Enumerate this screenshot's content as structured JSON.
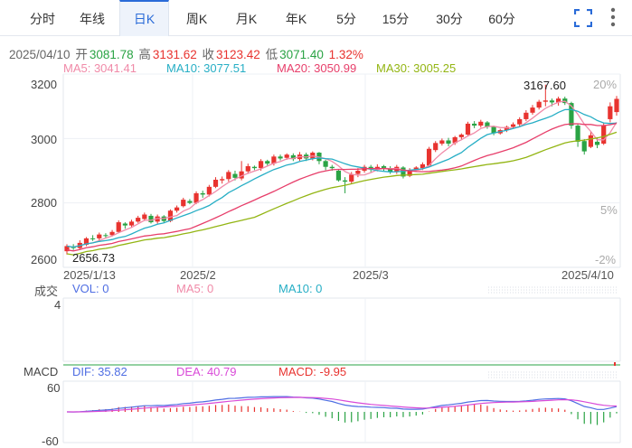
{
  "tabs": [
    {
      "label": "分时",
      "active": false
    },
    {
      "label": "年线",
      "active": false
    },
    {
      "label": "日K",
      "active": true
    },
    {
      "label": "周K",
      "active": false
    },
    {
      "label": "月K",
      "active": false
    },
    {
      "label": "年K",
      "active": false
    },
    {
      "label": "5分",
      "active": false
    },
    {
      "label": "15分",
      "active": false
    },
    {
      "label": "30分",
      "active": false
    },
    {
      "label": "60分",
      "active": false
    }
  ],
  "ohlc": {
    "date": "2025/04/10",
    "open_label": "开",
    "open": "3081.78",
    "high_label": "高",
    "high": "3131.62",
    "close_label": "收",
    "close": "3123.42",
    "low_label": "低",
    "low": "3071.40",
    "change": "1.32%"
  },
  "ma": {
    "ma5": "MA5: 3041.41",
    "ma10": "MA10: 3077.51",
    "ma20": "MA20: 3050.99",
    "ma30": "MA30: 3005.25"
  },
  "price_axis": [
    "3200",
    "3000",
    "2800",
    "2600"
  ],
  "pct_axis": [
    "20%",
    "5%",
    "-2%"
  ],
  "annotations": {
    "high": "3167.60",
    "low": "2656.73"
  },
  "date_axis": [
    "2025/1/13",
    "2025/2",
    "2025/3",
    "2025/4/10"
  ],
  "volume": {
    "title": "成交",
    "vol": "VOL: 0",
    "ma5": "MA5: 0",
    "ma10": "MA10: 0",
    "axis": "4"
  },
  "macd": {
    "title": "MACD",
    "dif": "DIF: 35.82",
    "dea": "DEA: 40.79",
    "macd": "MACD: -9.95",
    "axis_top": "60",
    "axis_bottom": "-60"
  },
  "colors": {
    "up": "#e8332f",
    "down": "#2aa344",
    "ma5": "#f08aa8",
    "ma10": "#26aec5",
    "ma20": "#e73e6a",
    "ma30": "#93b513",
    "dif": "#4f6ee3",
    "dea": "#d94ad8",
    "accent": "#2a6bd8"
  },
  "icons": [
    "fullscreen-icon",
    "more-menu-icon"
  ],
  "chart_data": {
    "type": "candlestick",
    "x_range": [
      "2025/1/13",
      "2025/4/10"
    ],
    "ylim": [
      2600,
      3200
    ],
    "candles": [
      [
        2650,
        2666,
        2640,
        2672
      ],
      [
        2664,
        2660,
        2654,
        2672
      ],
      [
        2660,
        2676,
        2654,
        2684
      ],
      [
        2670,
        2690,
        2666,
        2694
      ],
      [
        2690,
        2688,
        2682,
        2700
      ],
      [
        2690,
        2702,
        2684,
        2708
      ],
      [
        2700,
        2698,
        2692,
        2706
      ],
      [
        2700,
        2710,
        2696,
        2716
      ],
      [
        2710,
        2740,
        2706,
        2746
      ],
      [
        2736,
        2730,
        2720,
        2740
      ],
      [
        2730,
        2742,
        2724,
        2748
      ],
      [
        2742,
        2754,
        2738,
        2760
      ],
      [
        2750,
        2764,
        2744,
        2770
      ],
      [
        2760,
        2740,
        2736,
        2766
      ],
      [
        2742,
        2758,
        2736,
        2764
      ],
      [
        2758,
        2744,
        2738,
        2762
      ],
      [
        2744,
        2776,
        2740,
        2780
      ],
      [
        2776,
        2786,
        2770,
        2792
      ],
      [
        2790,
        2810,
        2786,
        2816
      ],
      [
        2806,
        2800,
        2796,
        2812
      ],
      [
        2800,
        2830,
        2796,
        2836
      ],
      [
        2830,
        2826,
        2816,
        2838
      ],
      [
        2826,
        2850,
        2820,
        2856
      ],
      [
        2850,
        2872,
        2846,
        2880
      ],
      [
        2870,
        2874,
        2860,
        2882
      ],
      [
        2874,
        2896,
        2866,
        2902
      ],
      [
        2890,
        2878,
        2870,
        2900
      ],
      [
        2876,
        2898,
        2870,
        2930
      ],
      [
        2898,
        2914,
        2890,
        2922
      ],
      [
        2912,
        2908,
        2902,
        2916
      ],
      [
        2908,
        2930,
        2900,
        2936
      ],
      [
        2930,
        2922,
        2916,
        2934
      ],
      [
        2922,
        2944,
        2916,
        2950
      ],
      [
        2944,
        2938,
        2932,
        2950
      ],
      [
        2940,
        2950,
        2934,
        2954
      ],
      [
        2948,
        2936,
        2930,
        2954
      ],
      [
        2936,
        2950,
        2930,
        2958
      ],
      [
        2950,
        2938,
        2930,
        2956
      ],
      [
        2938,
        2956,
        2932,
        2960
      ],
      [
        2956,
        2930,
        2920,
        2958
      ],
      [
        2930,
        2912,
        2902,
        2934
      ],
      [
        2912,
        2908,
        2900,
        2918
      ],
      [
        2900,
        2870,
        2866,
        2904
      ],
      [
        2870,
        2866,
        2830,
        2880
      ],
      [
        2866,
        2888,
        2860,
        2896
      ],
      [
        2890,
        2900,
        2880,
        2908
      ],
      [
        2900,
        2912,
        2894,
        2918
      ],
      [
        2912,
        2904,
        2896,
        2918
      ],
      [
        2904,
        2912,
        2898,
        2920
      ],
      [
        2914,
        2908,
        2900,
        2918
      ],
      [
        2908,
        2896,
        2890,
        2914
      ],
      [
        2896,
        2912,
        2890,
        2918
      ],
      [
        2910,
        2882,
        2876,
        2914
      ],
      [
        2884,
        2902,
        2880,
        2908
      ],
      [
        2900,
        2910,
        2896,
        2914
      ],
      [
        2908,
        2920,
        2902,
        2926
      ],
      [
        2916,
        2968,
        2912,
        2974
      ],
      [
        2964,
        2986,
        2958,
        2992
      ],
      [
        2984,
        2994,
        2978,
        3000
      ],
      [
        2994,
        2984,
        2976,
        3002
      ],
      [
        2986,
        3004,
        2980,
        3008
      ],
      [
        3004,
        3012,
        2998,
        3016
      ],
      [
        3012,
        3046,
        3006,
        3052
      ],
      [
        3046,
        3040,
        3032,
        3054
      ],
      [
        3040,
        3052,
        3034,
        3058
      ],
      [
        3050,
        3036,
        3030,
        3054
      ],
      [
        3036,
        3016,
        3010,
        3040
      ],
      [
        3016,
        3026,
        3012,
        3030
      ],
      [
        3026,
        3036,
        3020,
        3040
      ],
      [
        3036,
        3044,
        3030,
        3050
      ],
      [
        3044,
        3060,
        3038,
        3066
      ],
      [
        3060,
        3080,
        3054,
        3088
      ],
      [
        3080,
        3096,
        3074,
        3104
      ],
      [
        3096,
        3114,
        3090,
        3120
      ],
      [
        3114,
        3118,
        3100,
        3167
      ],
      [
        3118,
        3112,
        3100,
        3124
      ],
      [
        3112,
        3124,
        3102,
        3130
      ],
      [
        3124,
        3110,
        3104,
        3130
      ],
      [
        3110,
        3040,
        3030,
        3114
      ],
      [
        3040,
        2990,
        2974,
        3046
      ],
      [
        2992,
        2960,
        2950,
        2998
      ],
      [
        2974,
        3010,
        2970,
        3020
      ],
      [
        2990,
        2980,
        2970,
        3004
      ],
      [
        2984,
        3040,
        2980,
        3048
      ],
      [
        3060,
        3100,
        3050,
        3112
      ],
      [
        3082,
        3123,
        3071,
        3132
      ]
    ]
  }
}
